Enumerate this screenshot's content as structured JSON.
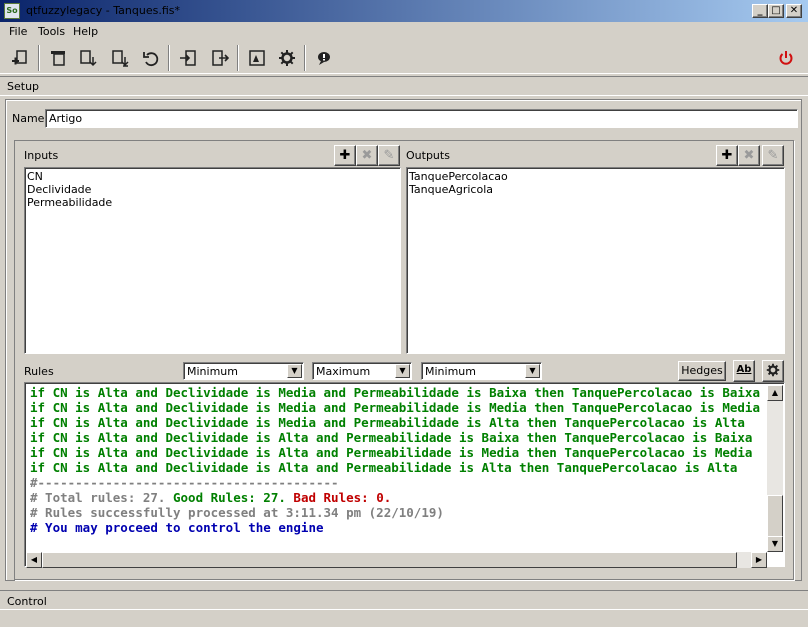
{
  "window": {
    "app_icon": "So",
    "title": "qtfuzzylegacy - Tanques.fis*",
    "minimize": "_",
    "maximize": "□",
    "close": "✕"
  },
  "menu": [
    "File",
    "Tools",
    "Help"
  ],
  "toolbar": {
    "icons": [
      "new-file-icon",
      "copy-icon",
      "import-icon",
      "export-icon",
      "undo-icon",
      "import-arrow-icon",
      "export-arrow-icon",
      "edit-icon",
      "settings-icon",
      "about-icon",
      "power-icon"
    ]
  },
  "setup": {
    "tab_label": "Setup",
    "name_label": "Name",
    "name_value": "Artigo"
  },
  "inputs": {
    "label": "Inputs",
    "items": [
      "CN",
      "Declividade",
      "Permeabilidade"
    ]
  },
  "outputs": {
    "label": "Outputs",
    "items": [
      "TanquePercolacao",
      "TanqueAgricola"
    ]
  },
  "rules": {
    "label": "Rules",
    "conjunction": "Minimum",
    "disjunction": "Maximum",
    "implication": "Minimum",
    "hedges_label": "Hedges",
    "spell_label": "Ab",
    "lines": [
      {
        "text": "if CN is Alta and Declividade is Media and Permeabilidade is Baixa then TanquePercolacao is Baixa",
        "style": "green"
      },
      {
        "text": "if CN is Alta and Declividade is Media and Permeabilidade is Media then TanquePercolacao is Media",
        "style": "green"
      },
      {
        "text": "if CN is Alta and Declividade is Media and Permeabilidade is Alta then TanquePercolacao is Alta",
        "style": "green"
      },
      {
        "text": "if CN is Alta and Declividade is Alta and Permeabilidade is Baixa then TanquePercolacao is Baixa",
        "style": "green"
      },
      {
        "text": "if CN is Alta and Declividade is Alta and Permeabilidade is Media then TanquePercolacao is Media",
        "style": "green"
      },
      {
        "text": "if CN is Alta and Declividade is Alta and Permeabilidade is Alta then TanquePercolacao is Alta",
        "style": "green"
      },
      {
        "text": "#----------------------------------------",
        "style": "gray"
      }
    ],
    "summary": {
      "prefix": "# Total rules: 27. ",
      "good": "Good Rules: 27.",
      "bad": " Bad Rules: 0."
    },
    "processed": "# Rules successfully processed at 3:11.34 pm (22/10/19)",
    "proceed": "# You may proceed to control the engine"
  },
  "control": {
    "tab_label": "Control"
  }
}
